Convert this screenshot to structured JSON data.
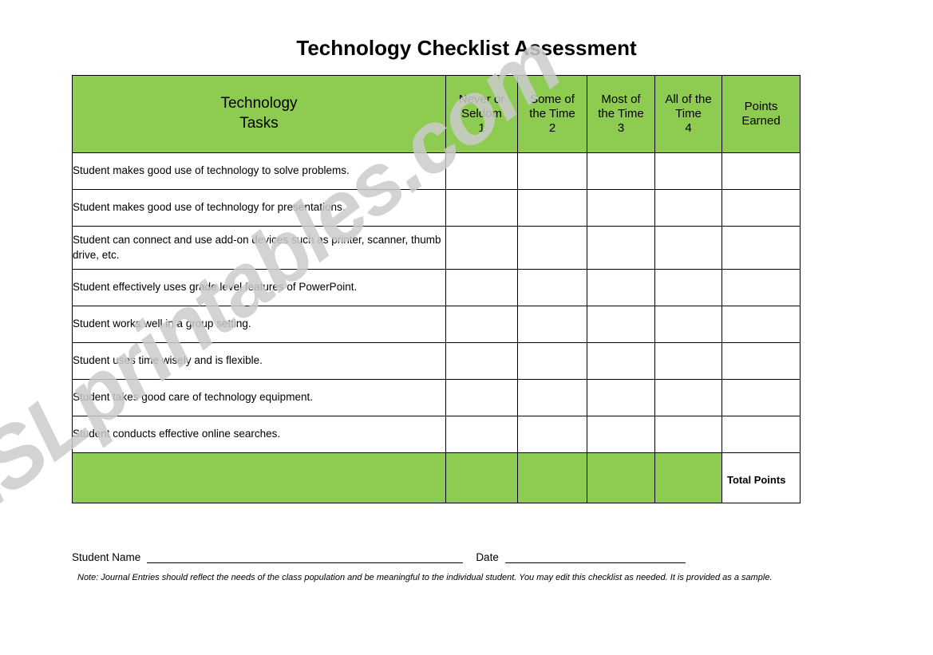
{
  "document": {
    "title": "Technology Checklist Assessment",
    "watermark": "ESLprintables.com"
  },
  "colors": {
    "header_green": "#8DCB51",
    "border": "#000000",
    "text": "#000000",
    "watermark_gray": "#cccccc"
  },
  "table": {
    "headers": {
      "tasks_line1": "Technology",
      "tasks_line2": "Tasks",
      "scales": [
        {
          "line1": "Never or",
          "line2": "Seldom",
          "line3": "1"
        },
        {
          "line1": "Some of",
          "line2": "the Time",
          "line3": "2"
        },
        {
          "line1": "Most of",
          "line2": "the Time",
          "line3": "3"
        },
        {
          "line1": "All of the",
          "line2": "Time",
          "line3": "4"
        },
        {
          "line1": "Points",
          "line2": "Earned",
          "line3": ""
        }
      ]
    },
    "rows": [
      {
        "task": "Student makes good use of technology to solve problems.",
        "never_or_seldom": "",
        "some_of_the_time": "",
        "most_of_the_time": "",
        "all_of_the_time": "",
        "points_earned": ""
      },
      {
        "task": "Student makes good use of technology for presentations.",
        "never_or_seldom": "",
        "some_of_the_time": "",
        "most_of_the_time": "",
        "all_of_the_time": "",
        "points_earned": ""
      },
      {
        "task": "Student can connect and use add-on devices such as printer, scanner, thumb drive, etc.",
        "never_or_seldom": "",
        "some_of_the_time": "",
        "most_of_the_time": "",
        "all_of_the_time": "",
        "points_earned": ""
      },
      {
        "task": "Student effectively uses grade level features of PowerPoint.",
        "never_or_seldom": "",
        "some_of_the_time": "",
        "most_of_the_time": "",
        "all_of_the_time": "",
        "points_earned": ""
      },
      {
        "task": "Student works well in a group setting.",
        "never_or_seldom": "",
        "some_of_the_time": "",
        "most_of_the_time": "",
        "all_of_the_time": "",
        "points_earned": ""
      },
      {
        "task": "Student uses time wisely and is flexible.",
        "never_or_seldom": "",
        "some_of_the_time": "",
        "most_of_the_time": "",
        "all_of_the_time": "",
        "points_earned": ""
      },
      {
        "task": "Student takes good care of technology equipment.",
        "never_or_seldom": "",
        "some_of_the_time": "",
        "most_of_the_time": "",
        "all_of_the_time": "",
        "points_earned": ""
      },
      {
        "task": "Student conducts effective online searches.",
        "never_or_seldom": "",
        "some_of_the_time": "",
        "most_of_the_time": "",
        "all_of_the_time": "",
        "points_earned": ""
      }
    ],
    "total_row": {
      "label": "Total Points",
      "value": ""
    }
  },
  "footer": {
    "student_name_label": "Student Name",
    "student_name_value": "",
    "date_label": "Date",
    "date_value": "",
    "note": "Note: Journal Entries should reflect the needs of the class population and be meaningful to the individual student.  You may edit this checklist as needed.  It is provided as a sample."
  }
}
